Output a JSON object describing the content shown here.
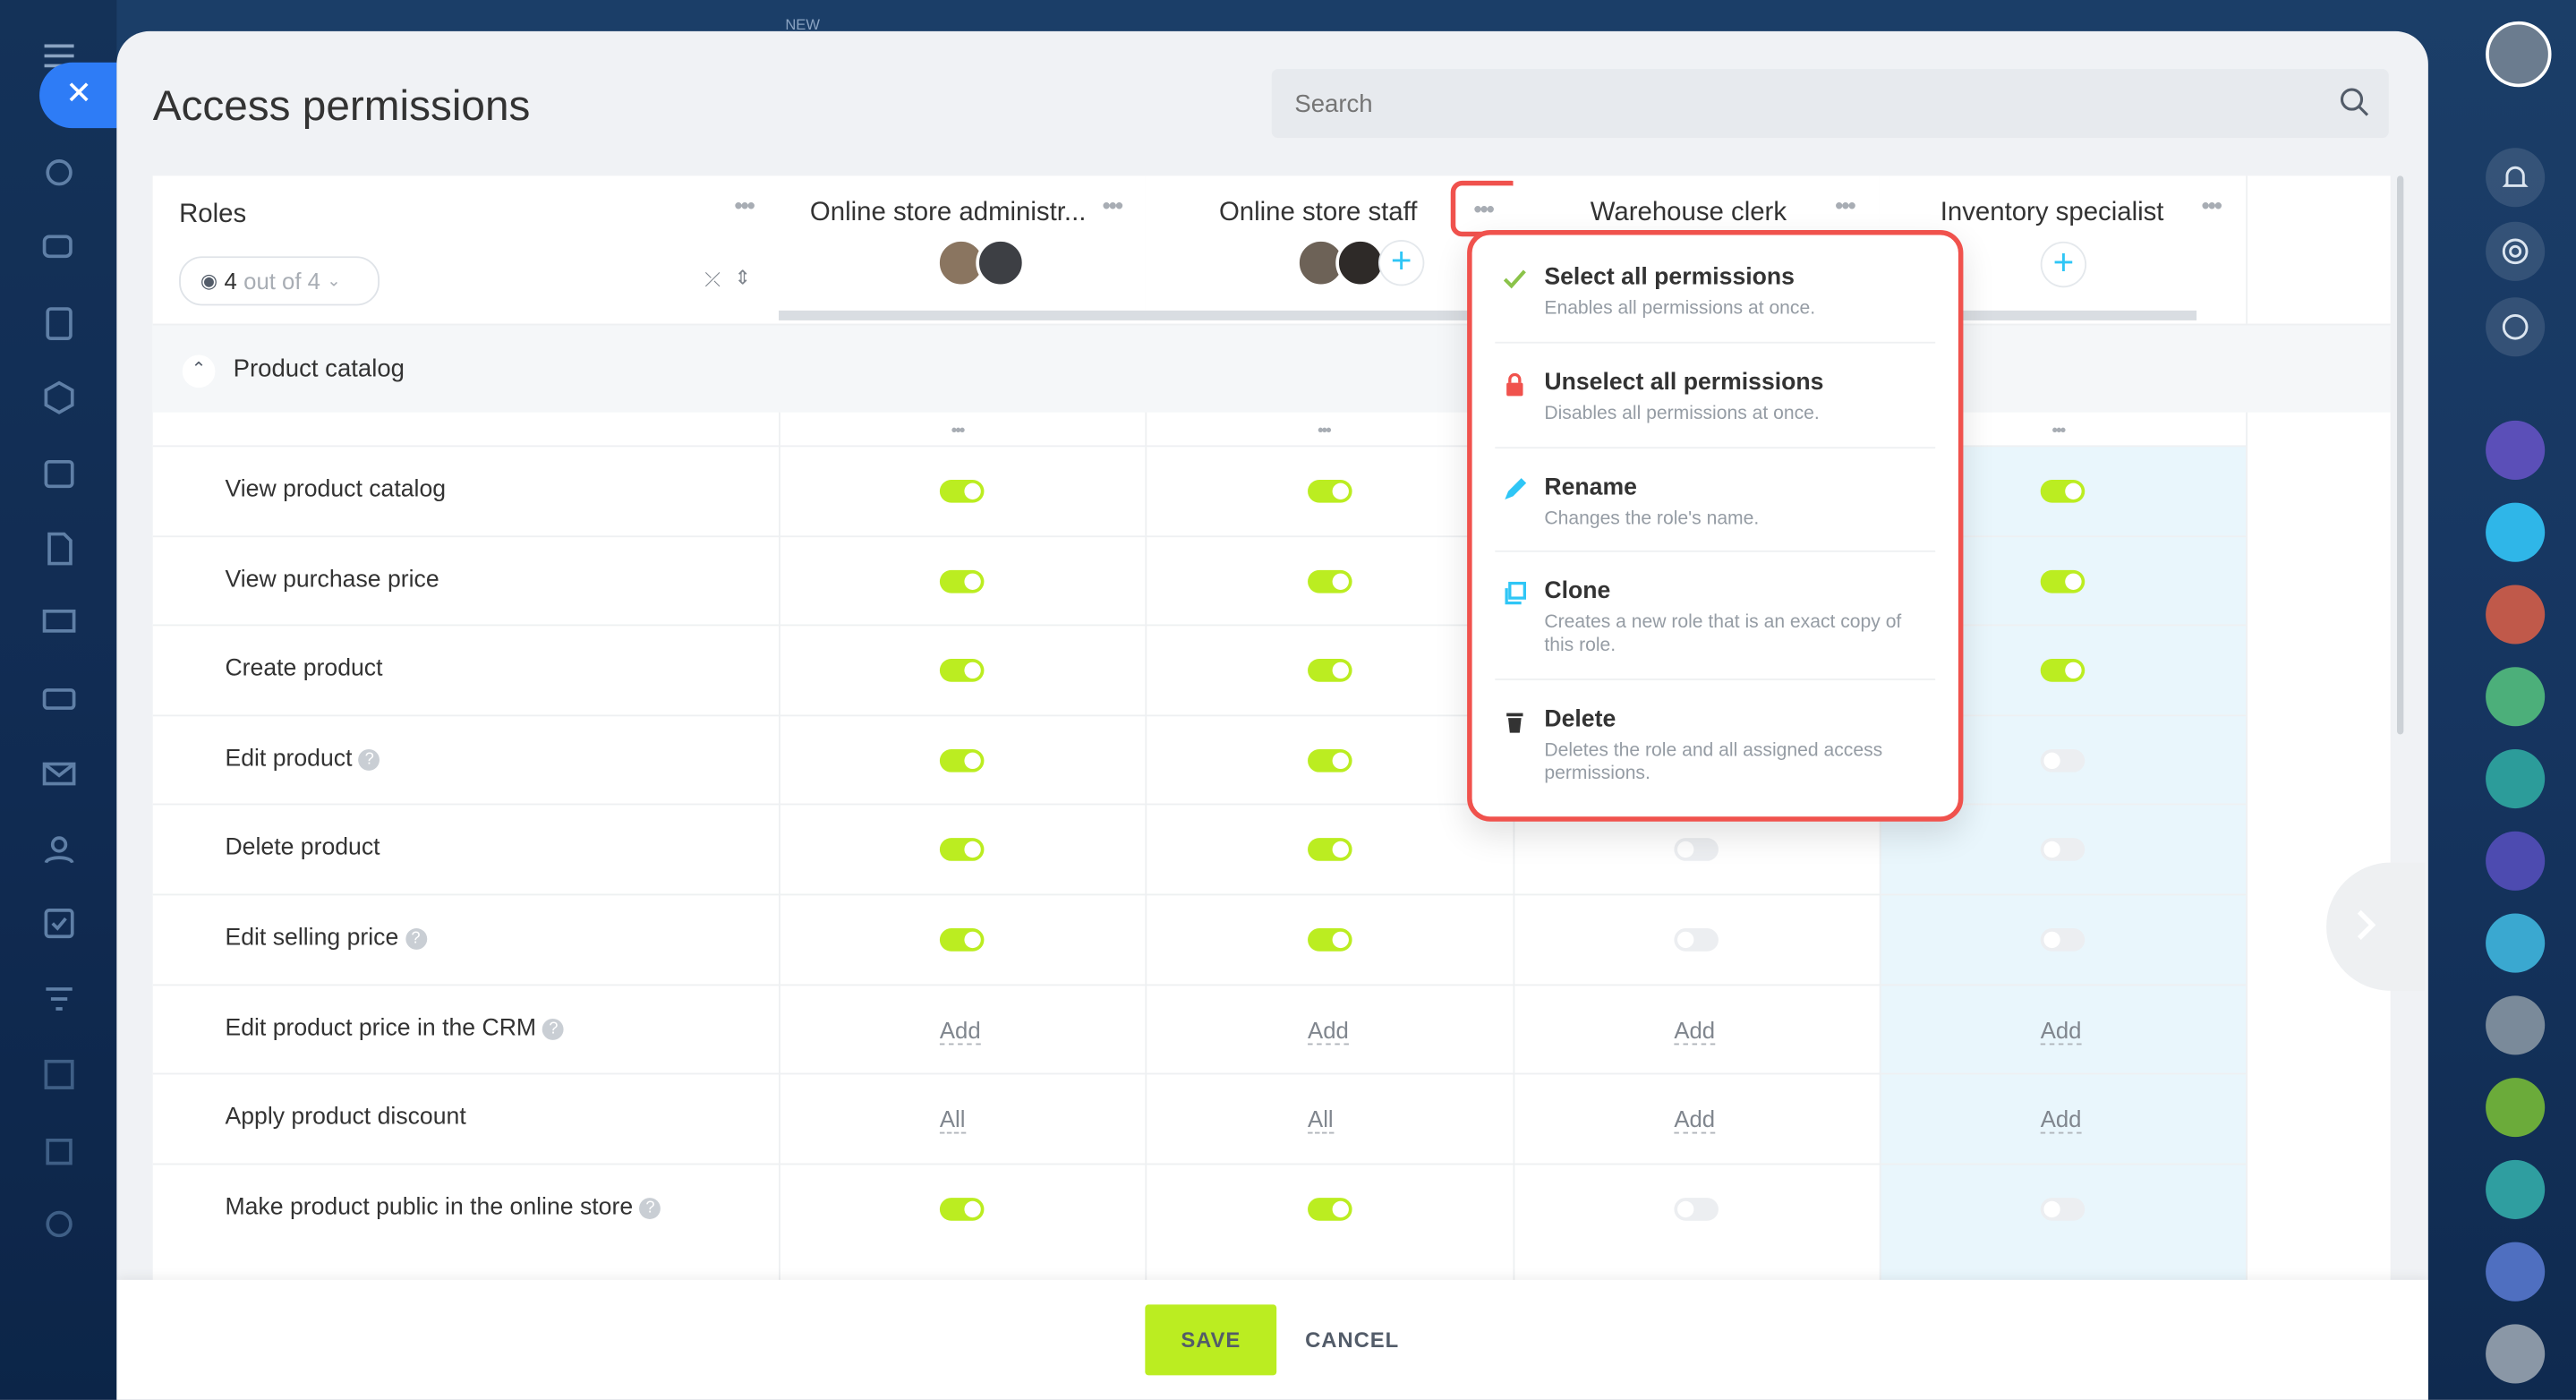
{
  "top_badge": "NEW",
  "panel": {
    "title": "Access permissions",
    "search_placeholder": "Search"
  },
  "roles_header": {
    "label": "Roles",
    "filter_count": "4",
    "filter_text": "out of 4"
  },
  "roles": [
    {
      "name": "Online store administr..."
    },
    {
      "name": "Online store staff"
    },
    {
      "name": "Warehouse clerk"
    },
    {
      "name": "Inventory specialist"
    }
  ],
  "section": {
    "title": "Product catalog"
  },
  "permissions": [
    {
      "label": "View product catalog",
      "help": false,
      "values": [
        "on",
        "on",
        "on",
        "on"
      ]
    },
    {
      "label": "View purchase price",
      "help": false,
      "values": [
        "on",
        "on",
        "on",
        "on"
      ]
    },
    {
      "label": "Create product",
      "help": false,
      "values": [
        "on",
        "on",
        "on",
        "on"
      ]
    },
    {
      "label": "Edit product",
      "help": true,
      "values": [
        "on",
        "on",
        "off",
        "off"
      ]
    },
    {
      "label": "Delete product",
      "help": false,
      "values": [
        "on",
        "on",
        "off",
        "off"
      ]
    },
    {
      "label": "Edit selling price",
      "help": true,
      "values": [
        "on",
        "on",
        "off",
        "off"
      ]
    },
    {
      "label": "Edit product price in the CRM",
      "help": true,
      "values": [
        "Add",
        "Add",
        "Add",
        "Add"
      ]
    },
    {
      "label": "Apply product discount",
      "help": false,
      "values": [
        "All",
        "All",
        "Add",
        "Add"
      ]
    },
    {
      "label": "Make product public in the online store",
      "help": true,
      "values": [
        "on",
        "on",
        "off",
        "off"
      ]
    }
  ],
  "context_menu": {
    "items": [
      {
        "title": "Select all permissions",
        "desc": "Enables all permissions at once.",
        "icon": "check-icon",
        "color": "#8bc34a"
      },
      {
        "title": "Unselect all permissions",
        "desc": "Disables all permissions at once.",
        "icon": "lock-icon",
        "color": "#f0524d"
      },
      {
        "title": "Rename",
        "desc": "Changes the role's name.",
        "icon": "pencil-icon",
        "color": "#2fc6f6"
      },
      {
        "title": "Clone",
        "desc": "Creates a new role that is an exact copy of this role.",
        "icon": "clone-icon",
        "color": "#2fc6f6"
      },
      {
        "title": "Delete",
        "desc": "Deletes the role and all assigned access permissions.",
        "icon": "trash-icon",
        "color": "#333333"
      }
    ]
  },
  "footer": {
    "save_label": "SAVE",
    "cancel_label": "CANCEL"
  },
  "colors": {
    "accent_green": "#bbed21",
    "highlight_red": "#f0524d",
    "blue": "#2e7cf6"
  }
}
